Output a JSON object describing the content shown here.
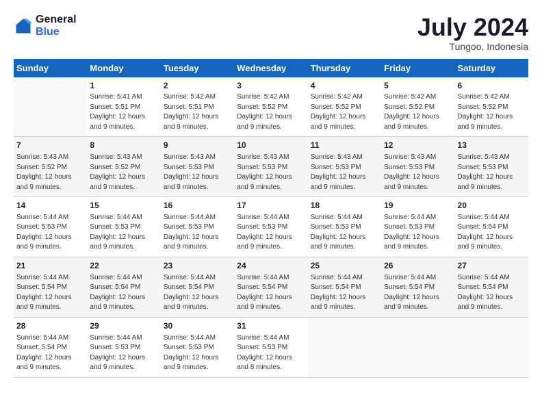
{
  "logo": {
    "general": "General",
    "blue": "Blue"
  },
  "title": "July 2024",
  "location": "Tungoo, Indonesia",
  "days_of_week": [
    "Sunday",
    "Monday",
    "Tuesday",
    "Wednesday",
    "Thursday",
    "Friday",
    "Saturday"
  ],
  "weeks": [
    [
      {
        "day": "",
        "info": ""
      },
      {
        "day": "1",
        "info": "Sunrise: 5:41 AM\nSunset: 5:51 PM\nDaylight: 12 hours\nand 9 minutes."
      },
      {
        "day": "2",
        "info": "Sunrise: 5:42 AM\nSunset: 5:51 PM\nDaylight: 12 hours\nand 9 minutes."
      },
      {
        "day": "3",
        "info": "Sunrise: 5:42 AM\nSunset: 5:52 PM\nDaylight: 12 hours\nand 9 minutes."
      },
      {
        "day": "4",
        "info": "Sunrise: 5:42 AM\nSunset: 5:52 PM\nDaylight: 12 hours\nand 9 minutes."
      },
      {
        "day": "5",
        "info": "Sunrise: 5:42 AM\nSunset: 5:52 PM\nDaylight: 12 hours\nand 9 minutes."
      },
      {
        "day": "6",
        "info": "Sunrise: 5:42 AM\nSunset: 5:52 PM\nDaylight: 12 hours\nand 9 minutes."
      }
    ],
    [
      {
        "day": "7",
        "info": "Sunrise: 5:43 AM\nSunset: 5:52 PM\nDaylight: 12 hours\nand 9 minutes."
      },
      {
        "day": "8",
        "info": "Sunrise: 5:43 AM\nSunset: 5:52 PM\nDaylight: 12 hours\nand 9 minutes."
      },
      {
        "day": "9",
        "info": "Sunrise: 5:43 AM\nSunset: 5:53 PM\nDaylight: 12 hours\nand 9 minutes."
      },
      {
        "day": "10",
        "info": "Sunrise: 5:43 AM\nSunset: 5:53 PM\nDaylight: 12 hours\nand 9 minutes."
      },
      {
        "day": "11",
        "info": "Sunrise: 5:43 AM\nSunset: 5:53 PM\nDaylight: 12 hours\nand 9 minutes."
      },
      {
        "day": "12",
        "info": "Sunrise: 5:43 AM\nSunset: 5:53 PM\nDaylight: 12 hours\nand 9 minutes."
      },
      {
        "day": "13",
        "info": "Sunrise: 5:43 AM\nSunset: 5:53 PM\nDaylight: 12 hours\nand 9 minutes."
      }
    ],
    [
      {
        "day": "14",
        "info": "Sunrise: 5:44 AM\nSunset: 5:53 PM\nDaylight: 12 hours\nand 9 minutes."
      },
      {
        "day": "15",
        "info": "Sunrise: 5:44 AM\nSunset: 5:53 PM\nDaylight: 12 hours\nand 9 minutes."
      },
      {
        "day": "16",
        "info": "Sunrise: 5:44 AM\nSunset: 5:53 PM\nDaylight: 12 hours\nand 9 minutes."
      },
      {
        "day": "17",
        "info": "Sunrise: 5:44 AM\nSunset: 5:53 PM\nDaylight: 12 hours\nand 9 minutes."
      },
      {
        "day": "18",
        "info": "Sunrise: 5:44 AM\nSunset: 5:53 PM\nDaylight: 12 hours\nand 9 minutes."
      },
      {
        "day": "19",
        "info": "Sunrise: 5:44 AM\nSunset: 5:53 PM\nDaylight: 12 hours\nand 9 minutes."
      },
      {
        "day": "20",
        "info": "Sunrise: 5:44 AM\nSunset: 5:54 PM\nDaylight: 12 hours\nand 9 minutes."
      }
    ],
    [
      {
        "day": "21",
        "info": "Sunrise: 5:44 AM\nSunset: 5:54 PM\nDaylight: 12 hours\nand 9 minutes."
      },
      {
        "day": "22",
        "info": "Sunrise: 5:44 AM\nSunset: 5:54 PM\nDaylight: 12 hours\nand 9 minutes."
      },
      {
        "day": "23",
        "info": "Sunrise: 5:44 AM\nSunset: 5:54 PM\nDaylight: 12 hours\nand 9 minutes."
      },
      {
        "day": "24",
        "info": "Sunrise: 5:44 AM\nSunset: 5:54 PM\nDaylight: 12 hours\nand 9 minutes."
      },
      {
        "day": "25",
        "info": "Sunrise: 5:44 AM\nSunset: 5:54 PM\nDaylight: 12 hours\nand 9 minutes."
      },
      {
        "day": "26",
        "info": "Sunrise: 5:44 AM\nSunset: 5:54 PM\nDaylight: 12 hours\nand 9 minutes."
      },
      {
        "day": "27",
        "info": "Sunrise: 5:44 AM\nSunset: 5:54 PM\nDaylight: 12 hours\nand 9 minutes."
      }
    ],
    [
      {
        "day": "28",
        "info": "Sunrise: 5:44 AM\nSunset: 5:54 PM\nDaylight: 12 hours\nand 9 minutes."
      },
      {
        "day": "29",
        "info": "Sunrise: 5:44 AM\nSunset: 5:53 PM\nDaylight: 12 hours\nand 9 minutes."
      },
      {
        "day": "30",
        "info": "Sunrise: 5:44 AM\nSunset: 5:53 PM\nDaylight: 12 hours\nand 9 minutes."
      },
      {
        "day": "31",
        "info": "Sunrise: 5:44 AM\nSunset: 5:53 PM\nDaylight: 12 hours\nand 8 minutes."
      },
      {
        "day": "",
        "info": ""
      },
      {
        "day": "",
        "info": ""
      },
      {
        "day": "",
        "info": ""
      }
    ]
  ]
}
